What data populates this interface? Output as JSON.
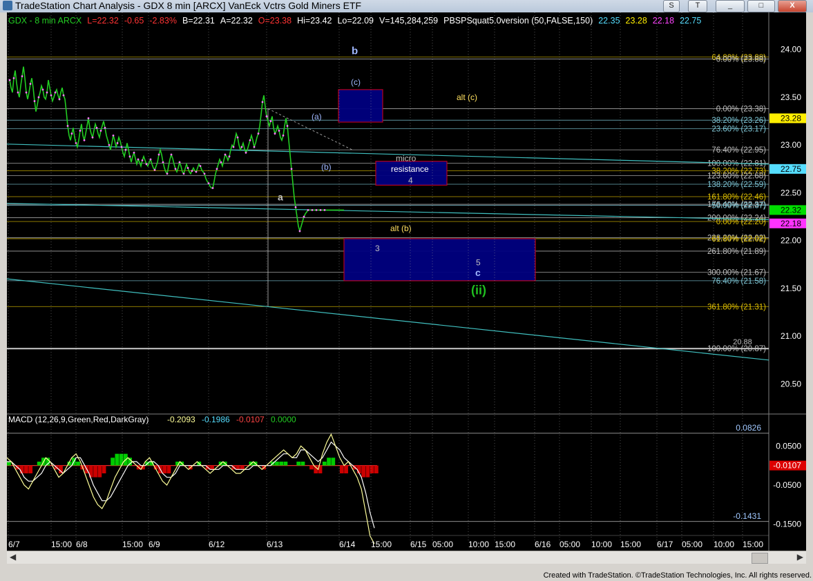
{
  "window": {
    "title": "TradeStation Chart Analysis - GDX 8 min [ARCX] VanEck Vctrs Gold Miners ETF",
    "buttons": [
      "S",
      "T",
      "_",
      "□",
      "X"
    ]
  },
  "colors": {
    "background": "#000000",
    "price": "#22cc22",
    "macd_line": "#ffff99",
    "macd_avg": "#ffffff",
    "hist_pos": "#00cc00",
    "hist_neg": "#cc0000",
    "fib_white": "#c0c0c0",
    "fib_cyan": "#7fc8d8",
    "fib_yellow": "#e0c000",
    "trend_cyan": "#40c0c0",
    "box_fill": "#000080",
    "box_border": "#c00020",
    "label_blue": "#a0b8ff",
    "label_yellow": "#ffe060",
    "label_green": "#20c020"
  },
  "header_line": [
    {
      "text": "GDX - 8 min  ARCX",
      "color": "#22cc22"
    },
    {
      "text": "L=22.32",
      "color": "#ff3333"
    },
    {
      "text": "-0.65",
      "color": "#ff3333"
    },
    {
      "text": "-2.83%",
      "color": "#ff3333"
    },
    {
      "text": "B=22.31",
      "color": "#ffffff"
    },
    {
      "text": "A=22.32",
      "color": "#ffffff"
    },
    {
      "text": "O=23.38",
      "color": "#ff3333"
    },
    {
      "text": "Hi=23.42",
      "color": "#ffffff"
    },
    {
      "text": "Lo=22.09",
      "color": "#ffffff"
    },
    {
      "text": "V=145,284,259",
      "color": "#ffffff"
    },
    {
      "text": "PBSPSquat5.0version (50,FALSE,150)",
      "color": "#ffffff"
    },
    {
      "text": "22.35",
      "color": "#55ddff"
    },
    {
      "text": "23.28",
      "color": "#ffee00"
    },
    {
      "text": "22.18",
      "color": "#ff44ff"
    },
    {
      "text": "22.75",
      "color": "#55ddff"
    }
  ],
  "chart_data": {
    "type": "line",
    "price_axis": {
      "ylim": [
        20.2,
        24.2
      ],
      "ticks": [
        "24.00",
        "23.50",
        "23.00",
        "22.50",
        "22.00",
        "21.50",
        "21.00",
        "20.50"
      ]
    },
    "price_markers": [
      {
        "value": 23.28,
        "label": "23.28",
        "bg": "#ffee00",
        "fg": "#000000"
      },
      {
        "value": 22.75,
        "label": "22.75",
        "bg": "#55ddff",
        "fg": "#000000"
      },
      {
        "value": 22.32,
        "label": "22.32",
        "bg": "#00dd00",
        "fg": "#000000"
      },
      {
        "value": 22.18,
        "label": "22.18",
        "bg": "#ff33ff",
        "fg": "#000000"
      }
    ],
    "x_axis": [
      "6/7",
      "15:00",
      "6/8",
      "15:00",
      "6/9",
      "6/12",
      "6/13",
      "6/14",
      "15:00",
      "6/15",
      "05:00",
      "10:00",
      "15:00",
      "6/16",
      "05:00",
      "10:00",
      "15:00",
      "6/17",
      "05:00",
      "10:00",
      "15:00"
    ],
    "price_series": {
      "name": "GDX",
      "x": [
        0,
        2,
        4,
        6,
        8,
        10,
        12,
        14,
        16,
        18,
        20,
        22,
        24,
        26,
        28,
        30,
        32,
        34,
        36,
        38,
        40,
        42,
        44,
        46,
        48,
        50,
        52,
        54,
        56,
        58,
        60,
        62,
        64,
        66,
        68,
        70,
        72,
        74,
        76,
        78,
        80,
        82,
        84,
        86,
        88,
        90,
        92,
        94,
        96,
        98,
        100,
        102,
        104,
        106,
        108,
        110,
        112,
        114,
        116,
        118,
        120,
        122,
        124,
        126,
        128,
        130,
        132,
        134,
        136,
        138,
        140,
        142,
        144,
        146,
        148,
        150,
        152,
        154,
        156,
        158,
        160,
        162,
        164,
        166,
        168,
        170,
        172,
        174,
        176,
        178,
        180,
        182,
        184,
        186,
        188,
        190,
        192,
        194,
        196,
        198,
        200,
        202,
        204,
        206,
        208,
        210,
        212,
        214,
        216,
        218,
        220,
        222,
        224,
        226,
        228,
        230,
        232,
        234,
        236,
        238,
        240,
        242,
        244,
        246,
        248,
        250,
        252,
        254,
        256,
        258,
        260,
        262,
        264,
        266,
        268,
        270,
        272,
        274,
        276,
        278,
        280,
        282,
        284,
        286,
        288,
        290,
        292,
        294,
        296,
        298,
        300,
        302,
        304,
        306,
        308,
        310,
        312,
        314,
        316,
        318,
        320,
        322,
        324,
        326,
        328,
        330,
        332,
        334,
        336,
        338,
        340,
        342,
        344,
        346,
        348,
        350,
        352,
        354,
        356,
        358,
        360,
        362,
        364,
        366,
        368,
        370,
        372,
        374,
        376,
        378,
        380,
        382,
        384,
        386,
        388,
        390,
        392,
        394,
        396,
        398,
        400,
        402,
        404,
        406,
        408,
        410,
        412,
        414,
        416,
        418,
        420,
        422,
        424,
        426,
        428,
        430,
        432,
        434,
        436,
        438,
        440,
        442,
        444,
        446,
        448,
        450,
        452,
        454,
        456,
        458,
        460,
        462,
        464,
        466,
        468,
        470,
        472,
        474,
        476,
        478,
        480,
        482,
        484,
        486,
        488,
        490,
        492,
        494,
        496,
        498,
        500,
        502,
        504,
        506,
        508,
        510,
        512,
        514,
        516,
        518,
        520,
        522,
        524,
        526,
        528
      ],
      "values": [
        23.68,
        23.6,
        23.55,
        23.7,
        23.78,
        23.65,
        23.55,
        23.5,
        23.62,
        23.72,
        23.82,
        23.7,
        23.55,
        23.48,
        23.55,
        23.64,
        23.7,
        23.6,
        23.46,
        23.35,
        23.42,
        23.5,
        23.55,
        23.62,
        23.58,
        23.5,
        23.48,
        23.55,
        23.68,
        23.6,
        23.52,
        23.46,
        23.5,
        23.55,
        23.58,
        23.52,
        23.48,
        23.55,
        23.6,
        23.52,
        23.48,
        23.35,
        23.2,
        23.1,
        23.05,
        23.12,
        23.18,
        23.08,
        23.02,
        22.98,
        23.05,
        23.15,
        23.22,
        23.1,
        23.05,
        23.12,
        23.2,
        23.28,
        23.18,
        23.12,
        23.08,
        23.15,
        23.22,
        23.18,
        23.12,
        23.08,
        23.15,
        23.2,
        23.25,
        23.18,
        23.1,
        23.05,
        23.0,
        22.95,
        23.02,
        23.1,
        23.05,
        22.98,
        23.02,
        23.08,
        23.04,
        22.98,
        22.92,
        22.88,
        22.95,
        23.02,
        22.95,
        22.88,
        22.82,
        22.88,
        22.92,
        22.86,
        22.8,
        22.85,
        22.82,
        22.78,
        22.84,
        22.88,
        22.84,
        22.8,
        22.78,
        22.82,
        22.85,
        22.8,
        22.76,
        22.74,
        22.78,
        22.82,
        22.9,
        22.95,
        22.9,
        22.82,
        22.76,
        22.72,
        22.7,
        22.78,
        22.85,
        22.9,
        22.86,
        22.8,
        22.75,
        22.72,
        22.76,
        22.82,
        22.78,
        22.72,
        22.7,
        22.75,
        22.8,
        22.76,
        22.72,
        22.7,
        22.73,
        22.76,
        22.73,
        22.72,
        22.76,
        22.8,
        22.78,
        22.74,
        22.72,
        22.7,
        22.65,
        22.62,
        22.6,
        22.57,
        22.55,
        22.55,
        22.62,
        22.7,
        22.75,
        22.8,
        22.85,
        22.82,
        22.78,
        22.84,
        22.9,
        22.88,
        22.84,
        22.88,
        22.95,
        23.0,
        22.98,
        23.05,
        23.12,
        23.08,
        23.0,
        22.95,
        22.98,
        23.02,
        22.96,
        22.92,
        22.95,
        23.0,
        23.05,
        23.1,
        23.05,
        22.98,
        23.02,
        23.08,
        23.12,
        23.2,
        23.32,
        23.45,
        23.52,
        23.4,
        23.3,
        23.25,
        23.2,
        23.25,
        23.3,
        23.18,
        23.12,
        23.15,
        23.2,
        23.15,
        23.08,
        23.05,
        23.1,
        23.2,
        23.28,
        23.2,
        23.05,
        22.9,
        22.75,
        22.6,
        22.45,
        22.35,
        22.25,
        22.15,
        22.1,
        22.15,
        22.2,
        22.25,
        22.28,
        22.3,
        22.32,
        22.32,
        22.32,
        22.32,
        22.32,
        22.32,
        22.32,
        22.32,
        22.32,
        22.32,
        22.32,
        22.32,
        22.32,
        22.32,
        22.32,
        22.32,
        22.32,
        22.32,
        22.32,
        22.32,
        22.32,
        22.32,
        22.32,
        22.32,
        22.32,
        22.32,
        22.32
      ]
    },
    "fib_levels": [
      {
        "value": 23.92,
        "label": "64.80% (23.88)",
        "color": "#e0c000"
      },
      {
        "value": 23.9,
        "label": "0.00% (23.88)",
        "color": "#c0c0c0"
      },
      {
        "value": 23.38,
        "label": "0.00% (23.38)",
        "color": "#c0c0c0"
      },
      {
        "value": 23.26,
        "label": "38.20% (23.26)",
        "color": "#7fc8d8"
      },
      {
        "value": 23.17,
        "label": "23.60% (23.17)",
        "color": "#7fc8d8"
      },
      {
        "value": 22.95,
        "label": "76.40% (22.95)",
        "color": "#c0c0c0"
      },
      {
        "value": 22.81,
        "label": "100.00% (22.81)",
        "color": "#c0c0c0"
      },
      {
        "value": 22.73,
        "label": "38.20% (22.73)",
        "color": "#e0c000"
      },
      {
        "value": 22.68,
        "label": "123.60% (22.68)",
        "color": "#c0c0c0"
      },
      {
        "value": 22.59,
        "label": "138.20% (22.59)",
        "color": "#7fc8d8"
      },
      {
        "value": 22.46,
        "label": "161.80% (22.46)",
        "color": "#e0c000"
      },
      {
        "value": 22.38,
        "label": "176.40% (22.37)",
        "color": "#c0c0c0"
      },
      {
        "value": 22.37,
        "label": "50.00% (22.37)",
        "color": "#7fc8d8"
      },
      {
        "value": 22.24,
        "label": "200.00% (22.24)",
        "color": "#c0c0c0"
      },
      {
        "value": 22.2,
        "label": "0.00% (22.20)",
        "color": "#e0c000"
      },
      {
        "value": 22.03,
        "label": "238.20% (22.02)",
        "color": "#c0c0c0"
      },
      {
        "value": 22.02,
        "label": "61.80% (22.02)",
        "color": "#e0c000"
      },
      {
        "value": 21.89,
        "label": "261.80% (21.89)",
        "color": "#c0c0c0"
      },
      {
        "value": 21.67,
        "label": "300.00% (21.67)",
        "color": "#c0c0c0"
      },
      {
        "value": 21.58,
        "label": "76.40% (21.58)",
        "color": "#7fc8d8"
      },
      {
        "value": 21.31,
        "label": "361.80% (21.31)",
        "color": "#e0c000"
      },
      {
        "value": 20.87,
        "label": "100.00% (20.87)",
        "color": "#c0c0c0"
      }
    ],
    "level_20_88": "20.88",
    "wave_labels": [
      {
        "text": "b",
        "x": 499,
        "value": 23.95,
        "color": "#a0b8ff",
        "bold": true,
        "size": 15
      },
      {
        "text": "(c)",
        "x": 498,
        "value": 23.63,
        "color": "#a0b8ff",
        "bold": false,
        "size": 12
      },
      {
        "text": "(a)",
        "x": 441,
        "value": 23.27,
        "color": "#a0b8ff",
        "bold": false,
        "size": 12
      },
      {
        "text": "(b)",
        "x": 455,
        "value": 22.74,
        "color": "#a0b8ff",
        "bold": false,
        "size": 12
      },
      {
        "text": "a",
        "x": 392,
        "value": 22.42,
        "color": "#c0c0c0",
        "bold": true,
        "size": 14
      },
      {
        "text": "alt (c)",
        "x": 651,
        "value": 23.47,
        "color": "#ffe060",
        "bold": false,
        "size": 12
      },
      {
        "text": "micro",
        "x": 563,
        "value": 22.83,
        "color": "#c0c0c0",
        "bold": false,
        "size": 12
      },
      {
        "text": "resistance",
        "x": 556,
        "value": 22.72,
        "color": "#ffffff",
        "bold": false,
        "size": 12
      },
      {
        "text": "4",
        "x": 581,
        "value": 22.6,
        "color": "#c0c0c0",
        "bold": false,
        "size": 12
      },
      {
        "text": "alt (b)",
        "x": 555,
        "value": 22.1,
        "color": "#ffe060",
        "bold": false,
        "size": 12
      },
      {
        "text": "3",
        "x": 533,
        "value": 21.89,
        "color": "#c0c0c0",
        "bold": false,
        "size": 12
      },
      {
        "text": "5",
        "x": 679,
        "value": 21.74,
        "color": "#c0c0c0",
        "bold": false,
        "size": 12
      },
      {
        "text": "c",
        "x": 678,
        "value": 21.63,
        "color": "#a0b8ff",
        "bold": true,
        "size": 14
      },
      {
        "text": "(ii)",
        "x": 672,
        "value": 21.44,
        "color": "#20c020",
        "bold": true,
        "size": 18
      }
    ],
    "boxes": [
      {
        "name": "b-target-box",
        "x0": 480,
        "x1": 544,
        "v0": 23.58,
        "v1": 23.24
      },
      {
        "name": "micro-resistance-box",
        "x0": 534,
        "x1": 637,
        "v0": 22.83,
        "v1": 22.58
      },
      {
        "name": "wave-c-target-box",
        "x0": 488,
        "x1": 765,
        "v0": 22.02,
        "v1": 21.58
      }
    ],
    "macd": {
      "label": "MACD (12,26,9,Green,Red,DarkGray)",
      "values": [
        {
          "text": "-0.2093",
          "color": "#ffff99"
        },
        {
          "text": "-0.1986",
          "color": "#55ddff"
        },
        {
          "text": "-0.0107",
          "color": "#ff4444"
        },
        {
          "text": "0.0000",
          "color": "#22cc22"
        }
      ],
      "ylim": [
        -0.2,
        0.1
      ],
      "ticks": [
        "0.0500",
        "-0.0500",
        "-0.1500"
      ],
      "levels": [
        {
          "value": 0.0826,
          "label": "0.0826"
        },
        {
          "value": -0.1431,
          "label": "-0.1431"
        }
      ],
      "current": "-0.0107",
      "macd_line": [
        0.02,
        0.01,
        -0.01,
        -0.03,
        -0.05,
        -0.06,
        -0.04,
        -0.02,
        0.0,
        0.02,
        0.01,
        -0.01,
        -0.03,
        -0.02,
        0.0,
        0.02,
        0.03,
        0.01,
        -0.02,
        -0.05,
        -0.08,
        -0.1,
        -0.11,
        -0.09,
        -0.06,
        -0.03,
        -0.01,
        0.01,
        0.02,
        0.01,
        0.0,
        -0.01,
        0.01,
        0.02,
        0.0,
        -0.02,
        -0.04,
        -0.05,
        -0.03,
        -0.01,
        0.01,
        0.0,
        -0.01,
        0.0,
        0.01,
        0.0,
        -0.01,
        -0.02,
        -0.01,
        0.0,
        0.01,
        0.0,
        -0.01,
        -0.02,
        -0.02,
        -0.01,
        0.0,
        0.01,
        0.0,
        -0.01,
        0.0,
        0.01,
        0.02,
        0.03,
        0.04,
        0.03,
        0.02,
        0.03,
        0.05,
        0.04,
        0.02,
        0.0,
        -0.01,
        0.03,
        0.06,
        0.08,
        0.05,
        0.02,
        0.0,
        0.01,
        -0.01,
        -0.03,
        -0.06,
        -0.12,
        -0.18,
        -0.2
      ],
      "signal_line": [
        0.01,
        0.01,
        0.0,
        -0.01,
        -0.03,
        -0.04,
        -0.04,
        -0.03,
        -0.02,
        0.0,
        0.01,
        0.0,
        -0.01,
        -0.02,
        -0.01,
        0.0,
        0.02,
        0.02,
        0.0,
        -0.02,
        -0.05,
        -0.07,
        -0.09,
        -0.09,
        -0.08,
        -0.06,
        -0.04,
        -0.02,
        0.0,
        0.01,
        0.01,
        0.0,
        0.0,
        0.01,
        0.01,
        0.0,
        -0.02,
        -0.03,
        -0.03,
        -0.02,
        0.0,
        0.0,
        0.0,
        0.0,
        0.0,
        0.0,
        0.0,
        -0.01,
        -0.01,
        -0.01,
        0.0,
        0.0,
        0.0,
        -0.01,
        -0.01,
        -0.01,
        -0.01,
        0.0,
        0.0,
        0.0,
        0.0,
        0.0,
        0.01,
        0.02,
        0.03,
        0.03,
        0.02,
        0.02,
        0.04,
        0.04,
        0.03,
        0.02,
        0.01,
        0.02,
        0.04,
        0.06,
        0.05,
        0.04,
        0.02,
        0.01,
        0.0,
        -0.01,
        -0.03,
        -0.07,
        -0.12,
        -0.16
      ],
      "histogram": [
        0.01,
        0.0,
        -0.01,
        -0.02,
        -0.02,
        -0.02,
        0.0,
        0.01,
        0.02,
        0.02,
        0.0,
        -0.01,
        -0.02,
        0.0,
        0.01,
        0.02,
        0.01,
        -0.01,
        -0.02,
        -0.03,
        -0.03,
        -0.03,
        -0.02,
        0.0,
        0.02,
        0.03,
        0.03,
        0.03,
        0.02,
        0.0,
        -0.01,
        -0.01,
        0.01,
        0.01,
        -0.01,
        -0.02,
        -0.02,
        -0.02,
        0.0,
        0.01,
        0.01,
        0.0,
        -0.01,
        0.0,
        0.01,
        0.0,
        -0.01,
        -0.01,
        0.0,
        0.01,
        0.01,
        0.0,
        -0.01,
        -0.01,
        -0.01,
        0.0,
        0.01,
        0.01,
        0.0,
        -0.01,
        0.0,
        0.01,
        0.01,
        0.01,
        0.01,
        0.0,
        0.0,
        0.01,
        0.01,
        0.0,
        -0.01,
        -0.02,
        -0.02,
        0.01,
        0.02,
        0.02,
        0.0,
        -0.02,
        -0.02,
        0.0,
        -0.01,
        -0.02,
        -0.03,
        -0.03,
        -0.02,
        -0.02
      ]
    }
  },
  "footer": "Created with TradeStation. ©TradeStation Technologies, Inc. All rights reserved."
}
